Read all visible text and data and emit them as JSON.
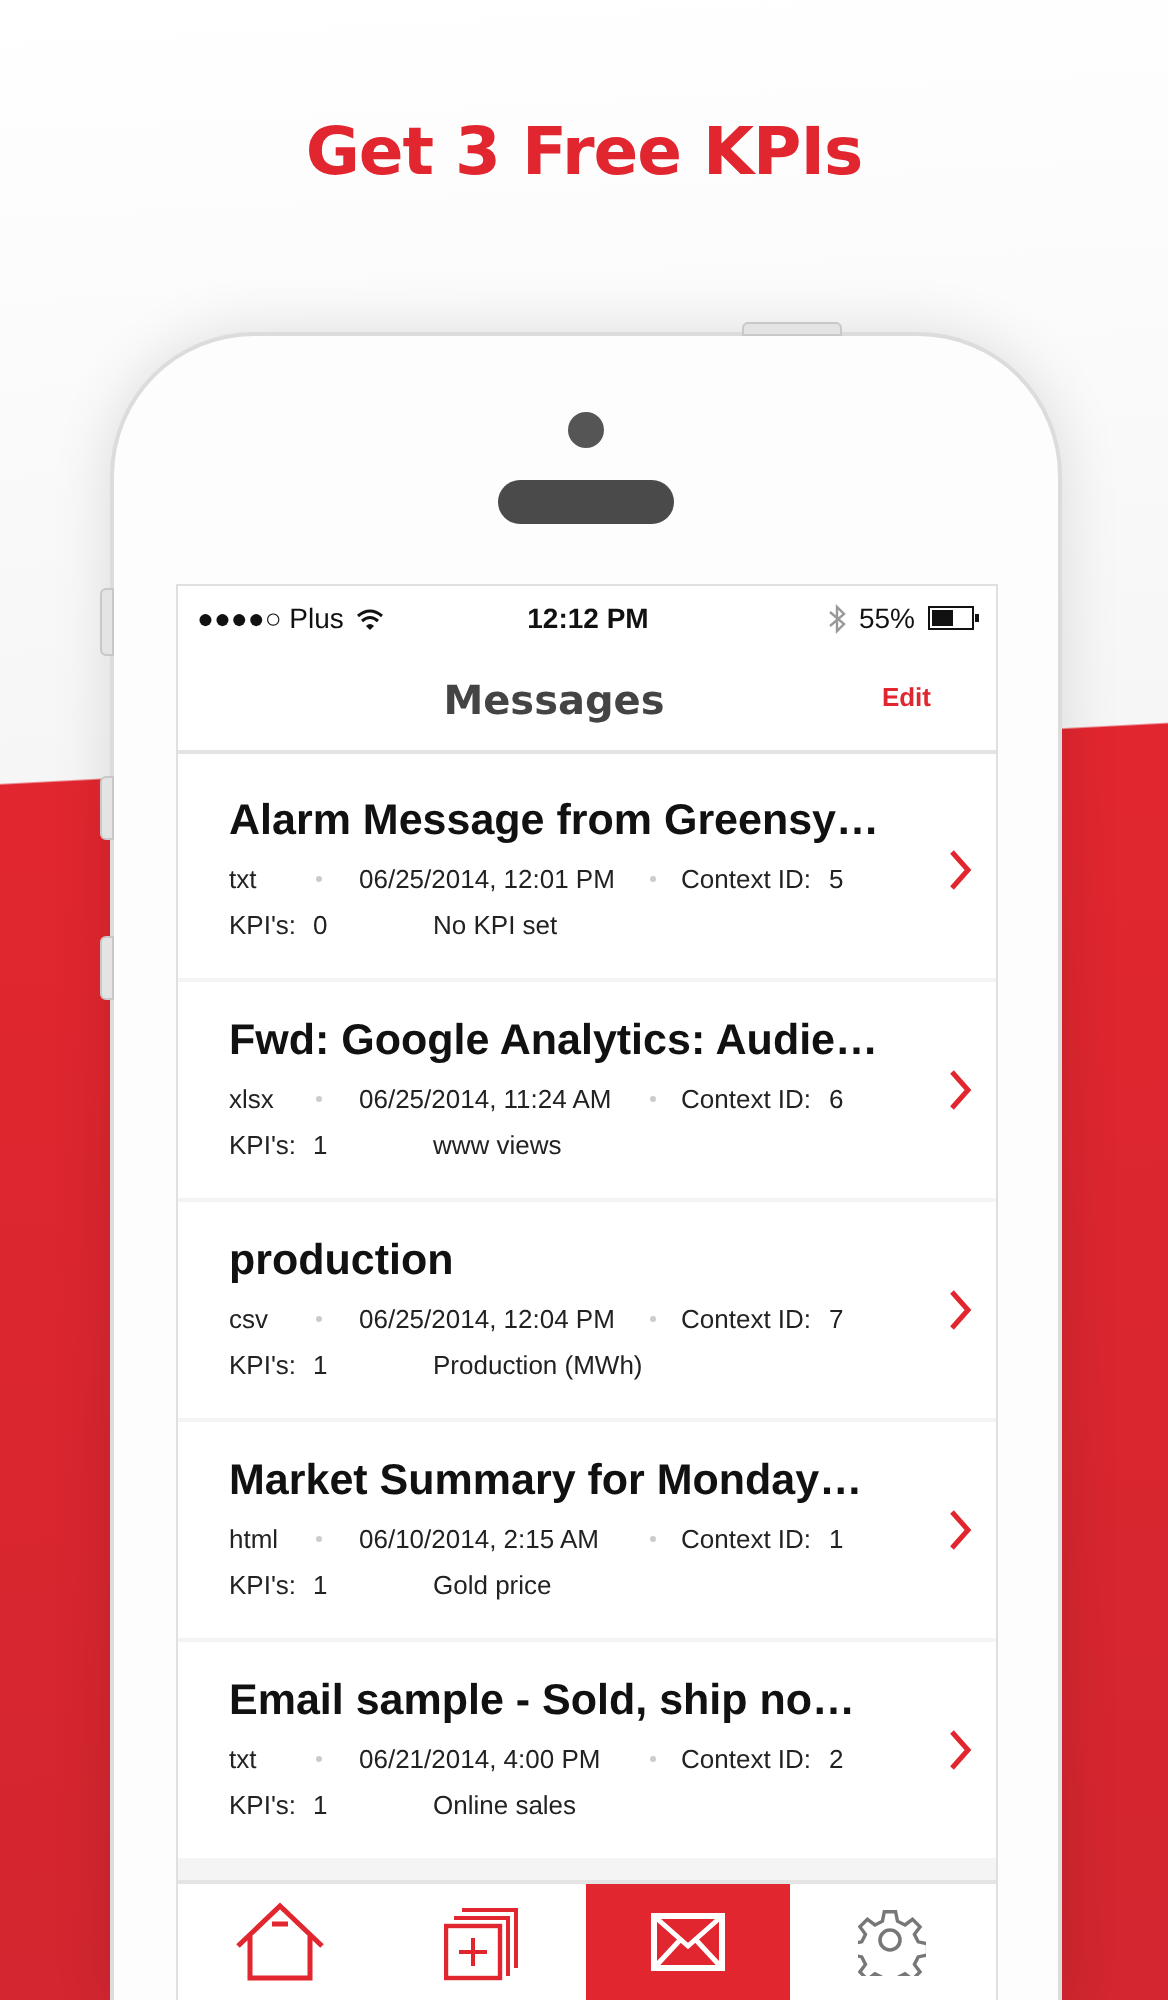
{
  "headline": "Get 3 Free KPIs",
  "status_bar": {
    "carrier": "●●●●○ Plus",
    "time": "12:12 PM",
    "battery": "55%"
  },
  "nav": {
    "title": "Messages",
    "edit": "Edit"
  },
  "messages": [
    {
      "title": "Alarm Message from Greensy…",
      "type": "txt",
      "date": "06/25/2014, 12:01 PM",
      "context_label": "Context ID:",
      "context_id": "5",
      "kpi_label": "KPI's:",
      "kpi_count": "0",
      "kpi_name": "No KPI set"
    },
    {
      "title": "Fwd: Google Analytics: Audie…",
      "type": "xlsx",
      "date": "06/25/2014, 11:24 AM",
      "context_label": "Context ID:",
      "context_id": "6",
      "kpi_label": "KPI's:",
      "kpi_count": "1",
      "kpi_name": "www views"
    },
    {
      "title": "production",
      "type": "csv",
      "date": "06/25/2014, 12:04 PM",
      "context_label": "Context ID:",
      "context_id": "7",
      "kpi_label": "KPI's:",
      "kpi_count": "1",
      "kpi_name": "Production (MWh)"
    },
    {
      "title": "Market Summary for Monday…",
      "type": "html",
      "date": "06/10/2014, 2:15 AM",
      "context_label": "Context ID:",
      "context_id": "1",
      "kpi_label": "KPI's:",
      "kpi_count": "1",
      "kpi_name": "Gold price"
    },
    {
      "title": "Email sample - Sold, ship no…",
      "type": "txt",
      "date": "06/21/2014, 4:00 PM",
      "context_label": "Context ID:",
      "context_id": "2",
      "kpi_label": "KPI's:",
      "kpi_count": "1",
      "kpi_name": "Online sales"
    }
  ],
  "tabs": [
    {
      "kind": "home",
      "selected": false
    },
    {
      "kind": "add",
      "selected": false
    },
    {
      "kind": "messages",
      "selected": true
    },
    {
      "kind": "settings",
      "selected": false
    }
  ]
}
